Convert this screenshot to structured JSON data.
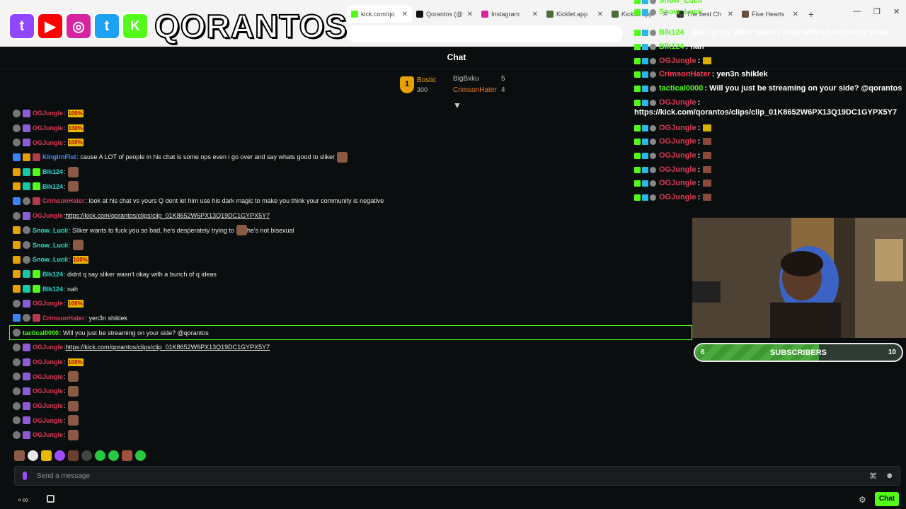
{
  "browser": {
    "tabs": [
      {
        "label": "kick.com/qo",
        "active": true,
        "color": "#53fc18"
      },
      {
        "label": "Qorantos (@",
        "active": false,
        "color": "#111111"
      },
      {
        "label": "Instagram",
        "active": false,
        "color": "#d6249f"
      },
      {
        "label": "Kicklet.app",
        "active": false,
        "color": "#4a6e3a"
      },
      {
        "label": "Kicklet.app",
        "active": false,
        "color": "#4a6e3a"
      },
      {
        "label": "The best Ch",
        "active": false,
        "color": "#333333"
      },
      {
        "label": "Five Hearts",
        "active": false,
        "color": "#6b4f3a"
      }
    ],
    "new_tab": "+",
    "window_controls": {
      "minimize": "—",
      "restore": "❐",
      "close": "✕"
    }
  },
  "banner": {
    "brand": "QORANTOS",
    "socials": [
      {
        "name": "twitch-icon",
        "glyph": "t",
        "color": "#9146ff"
      },
      {
        "name": "youtube-icon",
        "glyph": "▶",
        "color": "#ff0000"
      },
      {
        "name": "instagram-icon",
        "glyph": "◎",
        "color": "#d6249f"
      },
      {
        "name": "twitter-icon",
        "glyph": "t",
        "color": "#1da1f2"
      },
      {
        "name": "kick-icon",
        "glyph": "K",
        "color": "#53fc18"
      }
    ]
  },
  "chat": {
    "title": "Chat",
    "leaderboard": {
      "first": {
        "rank": "1",
        "name": "Bostic",
        "value": "300"
      },
      "second": {
        "name": "BigBxku",
        "count": "5"
      },
      "third": {
        "name": "CrimsonHater",
        "count": "4"
      }
    },
    "messages": [
      {
        "user": "OGJungle",
        "uclass": "u-red",
        "badges": [
          "b-grey",
          "b-purple"
        ],
        "text": ": ",
        "emote": "100%"
      },
      {
        "user": "OGJungle",
        "uclass": "u-red",
        "badges": [
          "b-grey",
          "b-purple"
        ],
        "text": ": ",
        "emote": "100%"
      },
      {
        "user": "OGJungle",
        "uclass": "u-red",
        "badges": [
          "b-grey",
          "b-purple"
        ],
        "text": ": ",
        "emote": "100%"
      },
      {
        "user": "KingIrnFist",
        "uclass": "u-blue",
        "badges": [
          "b-blue",
          "b-gold",
          "b-red"
        ],
        "text": ": cause A LOT of people in his chat is some ops even i go over and say whats good to sliker",
        "emote": "img"
      },
      {
        "user": "Blk124",
        "uclass": "u-cyan",
        "badges": [
          "b-gold",
          "b-teal",
          "b-green"
        ],
        "text": ": ",
        "emote": "img"
      },
      {
        "user": "Blk124",
        "uclass": "u-cyan",
        "badges": [
          "b-gold",
          "b-teal",
          "b-green"
        ],
        "text": ": ",
        "emote": "img"
      },
      {
        "user": "CrimsonHater",
        "uclass": "u-red",
        "badges": [
          "b-blue",
          "b-grey",
          "b-red"
        ],
        "text": ": look at his chat vs yours Q dont let him use his dark magic to make you think your community is negative",
        "emote": ""
      },
      {
        "user": "OGJungle",
        "uclass": "u-red",
        "badges": [
          "b-grey",
          "b-purple"
        ],
        "text": ": ",
        "link": "https://kick.com/qorantos/clips/clip_01K8652W6PX13Q19DC1GYPX5Y7",
        "emote": ""
      },
      {
        "user": "Snow_Lucii",
        "uclass": "u-teal",
        "badges": [
          "b-gold",
          "b-grey"
        ],
        "text": ": Sliker wants to fuck you so bad, he's desperately trying to ",
        "emote": "img",
        "after": " he's not bisexual"
      },
      {
        "user": "Snow_Lucii",
        "uclass": "u-teal",
        "badges": [
          "b-gold",
          "b-grey"
        ],
        "text": ": ",
        "emote": "img"
      },
      {
        "user": "Snow_Lucii",
        "uclass": "u-teal",
        "badges": [
          "b-gold",
          "b-grey"
        ],
        "text": ": ",
        "emote": "100%"
      },
      {
        "user": "Blk124",
        "uclass": "u-cyan",
        "badges": [
          "b-gold",
          "b-teal",
          "b-green"
        ],
        "text": ": didnt q say sliker wasn't okay with a bunch of q ideas",
        "emote": ""
      },
      {
        "user": "Blk124",
        "uclass": "u-cyan",
        "badges": [
          "b-gold",
          "b-teal",
          "b-green"
        ],
        "text": ": nah",
        "emote": ""
      },
      {
        "user": "OGJungle",
        "uclass": "u-red",
        "badges": [
          "b-grey",
          "b-purple"
        ],
        "text": ": ",
        "emote": "100%"
      },
      {
        "user": "CrimsonHater",
        "uclass": "u-red",
        "badges": [
          "b-blue",
          "b-grey",
          "b-red"
        ],
        "text": ": yen3n shiklek",
        "emote": ""
      },
      {
        "user": "tactical0000",
        "uclass": "u-green",
        "badges": [
          "b-grey"
        ],
        "text": ": Will you just be streaming on your side? @qorantos",
        "emote": "",
        "highlight": true
      },
      {
        "user": "OGJungle",
        "uclass": "u-red",
        "badges": [
          "b-grey",
          "b-purple"
        ],
        "text": ": ",
        "link": "https://kick.com/qorantos/clips/clip_01K8652W6PX13Q19DC1GYPX5Y7",
        "emote": ""
      },
      {
        "user": "OGJungle",
        "uclass": "u-red",
        "badges": [
          "b-grey",
          "b-purple"
        ],
        "text": ": ",
        "emote": "100%"
      },
      {
        "user": "OGJungle",
        "uclass": "u-red",
        "badges": [
          "b-grey",
          "b-purple"
        ],
        "text": ": ",
        "emote": "img"
      },
      {
        "user": "OGJungle",
        "uclass": "u-red",
        "badges": [
          "b-grey",
          "b-purple"
        ],
        "text": ": ",
        "emote": "img"
      },
      {
        "user": "OGJungle",
        "uclass": "u-red",
        "badges": [
          "b-grey",
          "b-purple"
        ],
        "text": ": ",
        "emote": "img"
      },
      {
        "user": "OGJungle",
        "uclass": "u-red",
        "badges": [
          "b-grey",
          "b-purple"
        ],
        "text": ": ",
        "emote": "img"
      },
      {
        "user": "OGJungle",
        "uclass": "u-red",
        "badges": [
          "b-grey",
          "b-purple"
        ],
        "text": ": ",
        "emote": "img"
      }
    ],
    "input_placeholder": "Send a message",
    "chat_button": "Chat"
  },
  "overlay_chat": {
    "messages": [
      {
        "user": "Snow_Lucii",
        "text": "",
        "style": "green"
      },
      {
        "user": "Snow_Lucii",
        "text": "",
        "style": "green"
      },
      {
        "user": "Blk124",
        "text": ": didnt q say sliker wasn't okay with a bunch of q ideas",
        "style": "green"
      },
      {
        "user": "Blk124",
        "text": ": nah",
        "style": "green"
      },
      {
        "user": "OGJungle",
        "text": ": ",
        "style": "red",
        "emote": "y"
      },
      {
        "user": "CrimsonHater",
        "text": ": yen3n shiklek",
        "style": "red2"
      },
      {
        "user": "tactical0000",
        "text": ": Will you just be streaming on your side? @qorantos",
        "style": "green"
      },
      {
        "user": "OGJungle",
        "text": ":",
        "style": "red"
      },
      {
        "user": "OGJungle",
        "text": ": ",
        "style": "red",
        "emote": "y"
      },
      {
        "user": "OGJungle",
        "text": ": ",
        "style": "red",
        "emote": "b"
      },
      {
        "user": "OGJungle",
        "text": ": ",
        "style": "red",
        "emote": "b"
      },
      {
        "user": "OGJungle",
        "text": ": ",
        "style": "red",
        "emote": "b"
      },
      {
        "user": "OGJungle",
        "text": ": ",
        "style": "red",
        "emote": "b"
      },
      {
        "user": "OGJungle",
        "text": ": ",
        "style": "red",
        "emote": "b"
      }
    ],
    "link": "https://kick.com/qorantos/clips/clip_01K8652W6PX13Q19DC1GYPX5Y7"
  },
  "sub_goal": {
    "current": "6",
    "label": "SUBSCRIBERS",
    "target": "10",
    "progress": 0.6
  }
}
